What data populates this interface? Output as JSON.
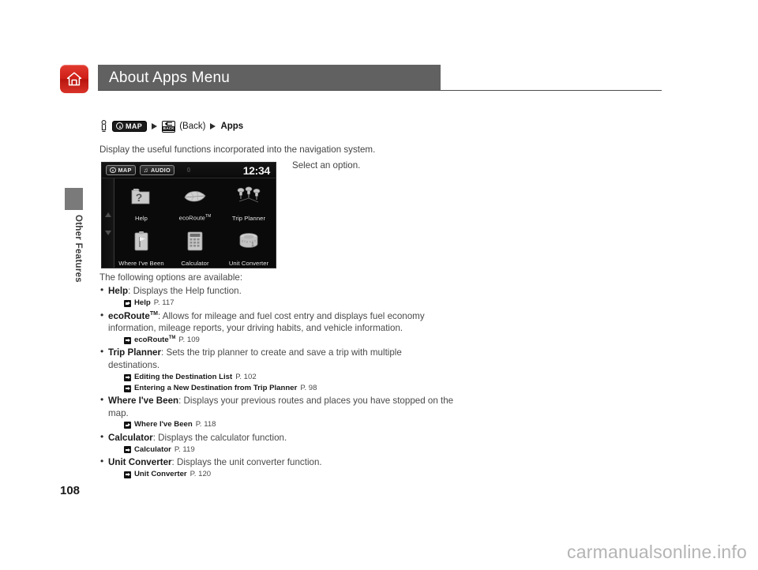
{
  "header": {
    "title": "About Apps Menu",
    "home_icon": "home-icon"
  },
  "sidebar": {
    "section_label": "Other Features",
    "page_number": "108"
  },
  "watermark": "carmanualsonline.info",
  "breadcrumb": {
    "hand_icon": "hand-pointer-icon",
    "map_button": "MAP",
    "back_button": "BACK",
    "back_caption": "(Back)",
    "destination": "Apps",
    "separator": "triangle-right-icon"
  },
  "intro": "Display the useful functions incorporated into the navigation system.",
  "select_note": "Select an option.",
  "nav_screen": {
    "status": {
      "map_chip": "MAP",
      "audio_chip": "AUDIO",
      "center_value": "0",
      "clock": "12:34"
    },
    "scroll": {
      "up": "arrow-up-icon",
      "down": "arrow-down-icon"
    },
    "apps": [
      {
        "label": "Help",
        "sup": "",
        "icon": "help-folder-icon"
      },
      {
        "label": "ecoRoute",
        "sup": "TM",
        "icon": "leaf-icon"
      },
      {
        "label": "Trip Planner",
        "sup": "",
        "icon": "pushpins-icon"
      },
      {
        "label": "Where I've Been",
        "sup": "",
        "icon": "clipboard-flag-icon"
      },
      {
        "label": "Calculator",
        "sup": "",
        "icon": "calculator-icon"
      },
      {
        "label": "Unit Converter",
        "sup": "",
        "icon": "tape-measure-icon"
      }
    ]
  },
  "body": {
    "lead": "The following options are available:",
    "options": [
      {
        "name": "Help",
        "sup": "",
        "desc": ": Displays the Help function.",
        "refs": [
          {
            "title": "Help",
            "sup": "",
            "page": "P. 117"
          }
        ]
      },
      {
        "name": "ecoRoute",
        "sup": "TM",
        "desc": ": Allows for mileage and fuel cost entry and displays fuel economy information, mileage reports, your driving habits, and vehicle information.",
        "refs": [
          {
            "title": "ecoRoute",
            "sup": "TM",
            "page": "P. 109"
          }
        ]
      },
      {
        "name": "Trip Planner",
        "sup": "",
        "desc": ": Sets the trip planner to create and save a trip with multiple destinations.",
        "refs": [
          {
            "title": "Editing the Destination List",
            "sup": "",
            "page": "P. 102"
          },
          {
            "title": "Entering a New Destination from Trip Planner",
            "sup": "",
            "page": "P. 98"
          }
        ]
      },
      {
        "name": "Where I've Been",
        "sup": "",
        "desc": ": Displays your previous routes and places you have stopped on the map.",
        "refs": [
          {
            "title": "Where I've Been",
            "sup": "",
            "page": "P. 118"
          }
        ]
      },
      {
        "name": "Calculator",
        "sup": "",
        "desc": ": Displays the calculator function.",
        "refs": [
          {
            "title": "Calculator",
            "sup": "",
            "page": "P. 119"
          }
        ]
      },
      {
        "name": "Unit Converter",
        "sup": "",
        "desc": ": Displays the unit converter function.",
        "refs": [
          {
            "title": "Unit Converter",
            "sup": "",
            "page": "P. 120"
          }
        ]
      }
    ]
  },
  "colors": {
    "header_bar": "#616161",
    "home_red": "#cf1f18",
    "screen_black": "#0a0a0a",
    "body_text": "#4a4a4a"
  }
}
